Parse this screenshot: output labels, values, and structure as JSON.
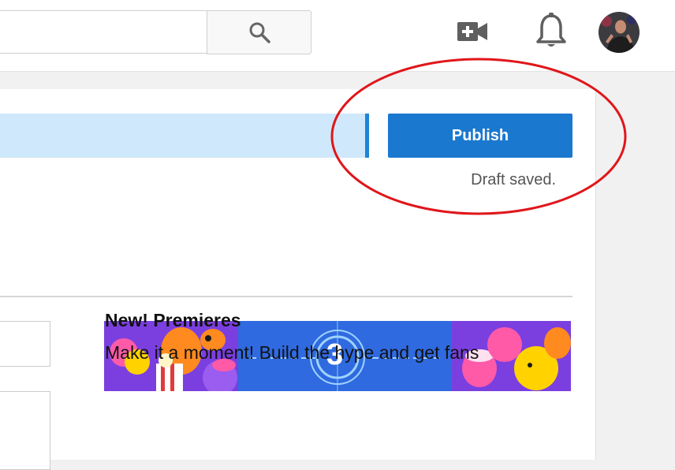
{
  "header": {
    "search": {
      "value": "",
      "placeholder": ""
    },
    "icons": {
      "search": "search-icon",
      "upload": "video-camera-plus-icon",
      "notifications": "bell-icon",
      "account": "avatar"
    }
  },
  "publish_panel": {
    "publish_label": "Publish",
    "draft_status": "Draft saved."
  },
  "promo": {
    "banner_countdown": "3",
    "title": "New! Premieres",
    "body": "Make it a moment! Build the hype and get fans"
  },
  "colors": {
    "accent": "#1b78cf",
    "progress_fill": "#cfe8fb",
    "annotation": "#e0161a"
  }
}
